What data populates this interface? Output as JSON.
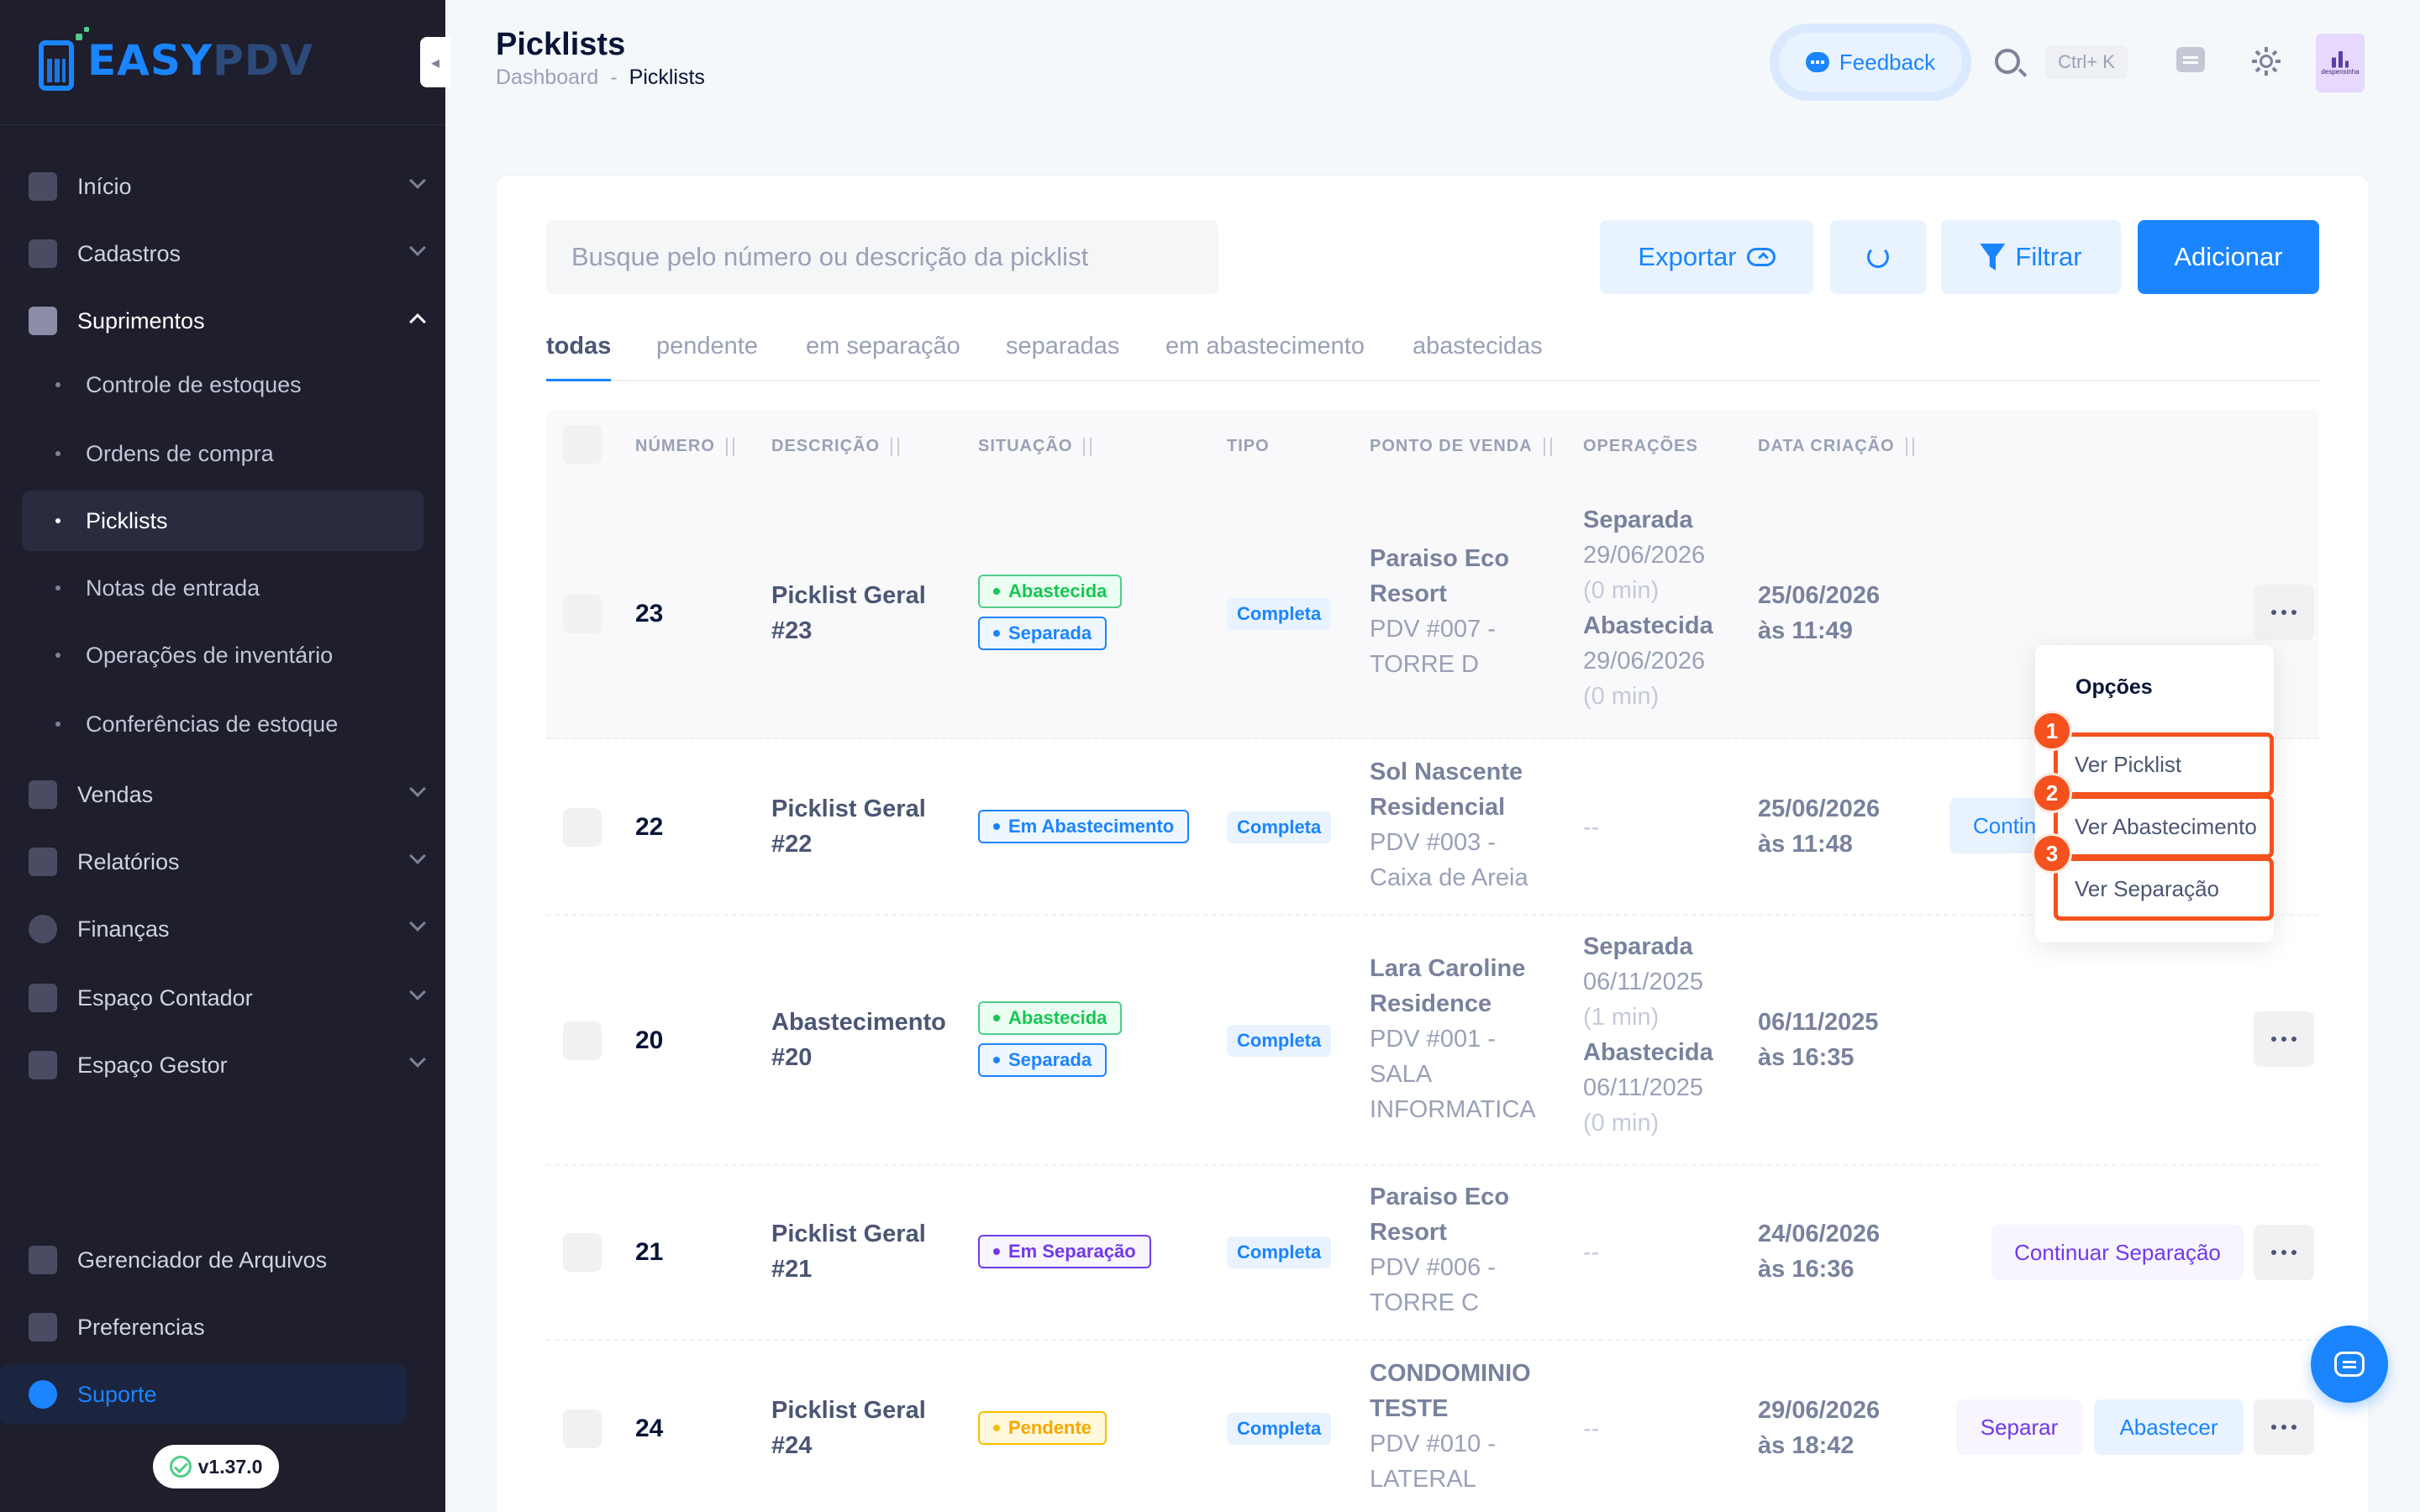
{
  "brand": {
    "part1": "EASY",
    "part2": "PDV"
  },
  "header": {
    "title": "Picklists",
    "breadcrumb": {
      "root": "Dashboard",
      "separator": "-",
      "current": "Picklists"
    },
    "feedback_label": "Feedback",
    "shortcut": "Ctrl+ K",
    "avatar_text": "despensinha"
  },
  "sidebar": {
    "items": [
      {
        "label": "Início"
      },
      {
        "label": "Cadastros"
      },
      {
        "label": "Suprimentos"
      },
      {
        "label": "Vendas"
      },
      {
        "label": "Relatórios"
      },
      {
        "label": "Finanças"
      },
      {
        "label": "Espaço Contador"
      },
      {
        "label": "Espaço Gestor"
      }
    ],
    "submenu": [
      {
        "label": "Controle de estoques"
      },
      {
        "label": "Ordens de compra"
      },
      {
        "label": "Picklists"
      },
      {
        "label": "Notas de entrada"
      },
      {
        "label": "Operações de inventário"
      },
      {
        "label": "Conferências de estoque"
      }
    ],
    "bottom": [
      {
        "label": "Gerenciador de Arquivos"
      },
      {
        "label": "Preferencias"
      },
      {
        "label": "Suporte"
      }
    ],
    "version": "v1.37.0"
  },
  "toolbar": {
    "search_placeholder": "Busque pelo número ou descrição da picklist",
    "export_label": "Exportar",
    "filter_label": "Filtrar",
    "add_label": "Adicionar"
  },
  "tabs": [
    "todas",
    "pendente",
    "em separação",
    "separadas",
    "em abastecimento",
    "abastecidas"
  ],
  "table": {
    "headers": [
      "NÚMERO",
      "DESCRIÇÃO",
      "SITUAÇÃO",
      "TIPO",
      "PONTO DE VENDA",
      "OPERAÇÕES",
      "DATA CRIAÇÃO"
    ],
    "rows": [
      {
        "numero": "23",
        "desc1": "Picklist Geral",
        "desc2": "#23",
        "badges": [
          "Abastecida",
          "Separada"
        ],
        "tipo": "Completa",
        "pdv": [
          "Paraiso Eco",
          "Resort",
          "PDV #007 -",
          "TORRE D"
        ],
        "ops": [
          "Separada",
          "29/06/2026",
          "(0 min)",
          "Abastecida",
          "29/06/2026",
          "(0 min)"
        ],
        "date1": "25/06/2026",
        "date2": "às 11:49"
      },
      {
        "numero": "22",
        "desc1": "Picklist Geral",
        "desc2": "#22",
        "badges": [
          "Em Abastecimento"
        ],
        "tipo": "Completa",
        "pdv": [
          "Sol Nascente",
          "Residencial",
          "PDV #003 -",
          "Caixa de Areia"
        ],
        "ops_empty": "--",
        "date1": "25/06/2026",
        "date2": "às 11:48",
        "action": "Contin"
      },
      {
        "numero": "20",
        "desc1": "Abastecimento",
        "desc2": "#20",
        "badges": [
          "Abastecida",
          "Separada"
        ],
        "tipo": "Completa",
        "pdv": [
          "Lara Caroline",
          "Residence",
          "PDV #001 -",
          "SALA",
          "INFORMATICA"
        ],
        "ops": [
          "Separada",
          "06/11/2025",
          "(1 min)",
          "Abastecida",
          "06/11/2025",
          "(0 min)"
        ],
        "date1": "06/11/2025",
        "date2": "às 16:35"
      },
      {
        "numero": "21",
        "desc1": "Picklist Geral",
        "desc2": "#21",
        "badges": [
          "Em Separação"
        ],
        "tipo": "Completa",
        "pdv": [
          "Paraiso Eco",
          "Resort",
          "PDV #006 -",
          "TORRE C"
        ],
        "ops_empty": "--",
        "date1": "24/06/2026",
        "date2": "às 16:36",
        "action": "Continuar Separação"
      },
      {
        "numero": "24",
        "desc1": "Picklist Geral",
        "desc2": "#24",
        "badges": [
          "Pendente"
        ],
        "tipo": "Completa",
        "pdv": [
          "CONDOMINIO",
          "TESTE",
          "PDV #010 -",
          "LATERAL"
        ],
        "ops_empty": "--",
        "date1": "29/06/2026",
        "date2": "às 18:42",
        "actions": [
          "Separar",
          "Abastecer"
        ]
      }
    ]
  },
  "dropdown": {
    "title": "Opções",
    "items": [
      "Ver Picklist",
      "Ver Abastecimento",
      "Ver Separação"
    ],
    "markers": [
      "1",
      "2",
      "3"
    ]
  },
  "colors": {
    "primary": "#1b84ff",
    "sidebar": "#1e1e2d",
    "highlight": "#f4511e",
    "success": "#17c653",
    "purple": "#7239ea",
    "warning": "#f6c000"
  }
}
